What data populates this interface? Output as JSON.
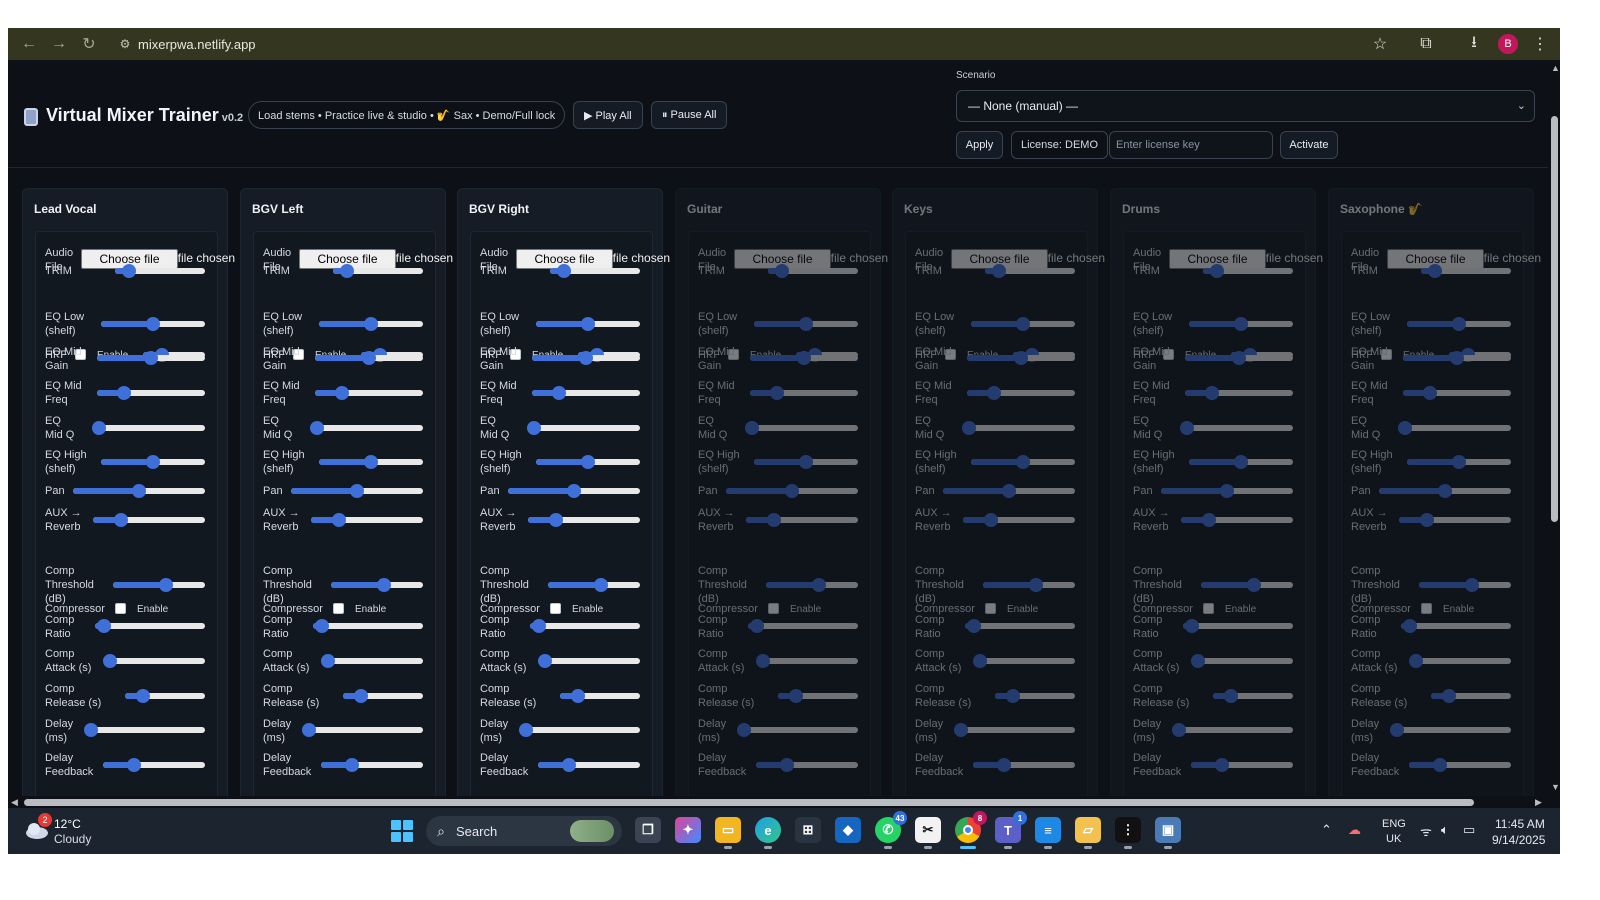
{
  "browser": {
    "url": "mixerpwa.netlify.app",
    "profile_initial": "B"
  },
  "header": {
    "title": "Virtual Mixer Trainer",
    "version": "v0.2",
    "tagline": "Load stems • Practice live & studio • 🎷 Sax • Demo/Full lock",
    "play_all": "▶ Play All",
    "pause_all": "⏸ Pause All",
    "scenario_label": "Scenario",
    "scenario_value": "— None (manual) —",
    "apply": "Apply",
    "license": "License: DEMO",
    "license_placeholder": "Enter license key",
    "activate": "Activate"
  },
  "labels": {
    "audio_file_1": "Audio",
    "audio_file_2": "File",
    "choose_file": "Choose file",
    "no_file": "No file chosen",
    "trim": "TRIM",
    "hpf": "HPF",
    "enable": "Enable",
    "eq_low_1": "EQ Low",
    "eq_low_2": "(shelf)",
    "eq_mid_gain_1": "EQ Mid",
    "eq_mid_gain_2": "Gain",
    "eq_mid_freq_1": "EQ Mid",
    "eq_mid_freq_2": "Freq",
    "eq_mid_q_1": "EQ",
    "eq_mid_q_2": "Mid Q",
    "eq_high_1": "EQ High",
    "eq_high_2": "(shelf)",
    "pan": "Pan",
    "aux_1": "AUX →",
    "aux_2": "Reverb",
    "compressor": "Compressor",
    "comp_thr_1": "Comp",
    "comp_thr_2": "Threshold",
    "comp_thr_3": "(dB)",
    "comp_ratio_1": "Comp",
    "comp_ratio_2": "Ratio",
    "comp_attack_1": "Comp",
    "comp_attack_2": "Attack (s)",
    "comp_release_1": "Comp",
    "comp_release_2": "Release (s)",
    "delay_1": "Delay",
    "delay_2": "(ms)",
    "delay_fb_1": "Delay",
    "delay_fb_2": "Feedback"
  },
  "slider_values": {
    "trim": 0.15,
    "hpf": 0.3,
    "eq_low": 0.5,
    "eq_mid_gain": 0.5,
    "eq_mid_freq": 0.25,
    "eq_mid_q": 0.05,
    "eq_high": 0.5,
    "pan": 0.5,
    "aux": 0.25,
    "comp_threshold": 0.58,
    "comp_ratio": 0.08,
    "comp_attack": 0.05,
    "comp_release": 0.22,
    "delay": 0.0,
    "delay_feedback": 0.3
  },
  "channels": [
    {
      "name": "Lead Vocal",
      "disabled": false
    },
    {
      "name": "BGV Left",
      "disabled": false
    },
    {
      "name": "BGV Right",
      "disabled": false
    },
    {
      "name": "Guitar",
      "disabled": true
    },
    {
      "name": "Keys",
      "disabled": true
    },
    {
      "name": "Drums",
      "disabled": true
    },
    {
      "name": "Saxophone 🎷",
      "disabled": true
    }
  ],
  "taskbar": {
    "weather_temp": "12°C",
    "weather_cond": "Cloudy",
    "weather_badge": "2",
    "search": "Search",
    "whatsapp_badge": "43",
    "chrome_badge": "8",
    "teams_badge": "1",
    "lang1": "ENG",
    "lang2": "UK",
    "time": "11:45 AM",
    "date": "9/14/2025"
  },
  "colors": {
    "accent": "#3f6fd8",
    "app_bg": "#0d1117",
    "browser_bar": "#35361f"
  }
}
